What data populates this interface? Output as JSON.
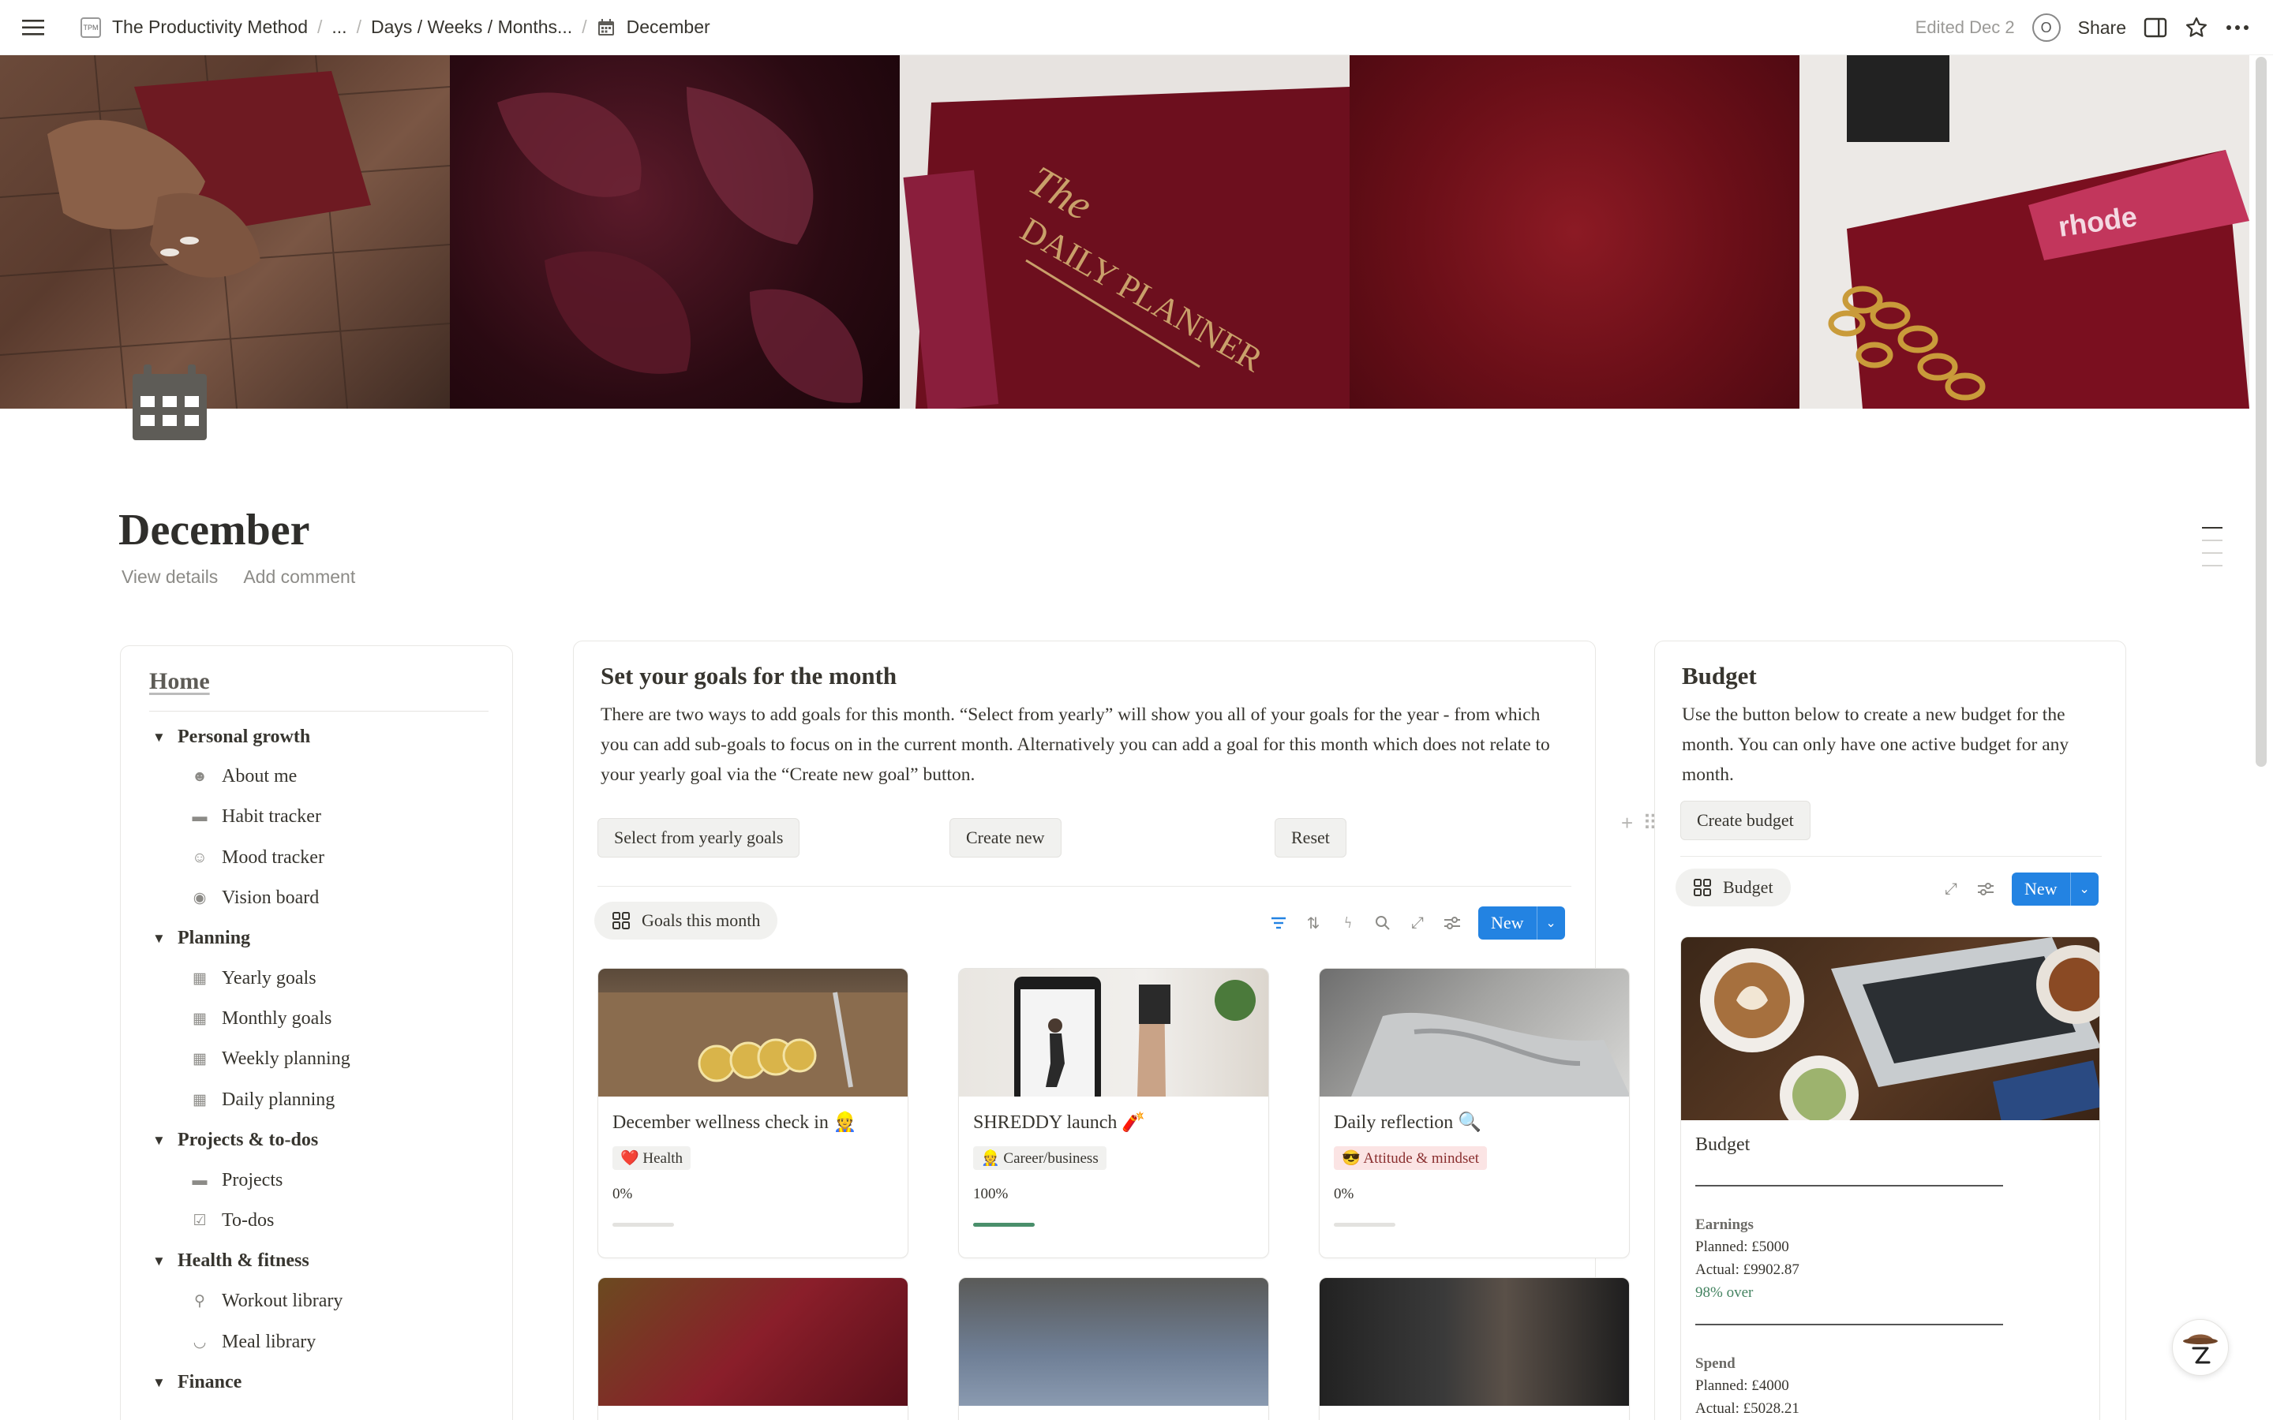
{
  "topbar": {
    "breadcrumbs": [
      "The Productivity Method",
      "...",
      "Days / Weeks / Months...",
      "December"
    ],
    "logo_text": "TPM",
    "edited": "Edited Dec 2",
    "avatar_letter": "O",
    "share": "Share"
  },
  "page": {
    "title": "December",
    "view_details": "View details",
    "add_comment": "Add comment"
  },
  "home": {
    "title": "Home",
    "sections": [
      {
        "label": "Personal growth",
        "items": [
          {
            "label": "About me",
            "icon": "user-icon"
          },
          {
            "label": "Habit tracker",
            "icon": "book-icon"
          },
          {
            "label": "Mood tracker",
            "icon": "smile-icon"
          },
          {
            "label": "Vision board",
            "icon": "eye-icon"
          }
        ]
      },
      {
        "label": "Planning",
        "items": [
          {
            "label": "Yearly goals",
            "icon": "calendar-icon"
          },
          {
            "label": "Monthly goals",
            "icon": "calendar-icon"
          },
          {
            "label": "Weekly planning",
            "icon": "calendar-icon"
          },
          {
            "label": "Daily planning",
            "icon": "calendar-icon"
          }
        ]
      },
      {
        "label": "Projects & to-dos",
        "items": [
          {
            "label": "Projects",
            "icon": "folder-icon"
          },
          {
            "label": "To-dos",
            "icon": "checkbox-icon"
          }
        ]
      },
      {
        "label": "Health & fitness",
        "items": [
          {
            "label": "Workout library",
            "icon": "dumbbell-icon"
          },
          {
            "label": "Meal library",
            "icon": "bowl-icon"
          }
        ]
      },
      {
        "label": "Finance",
        "items": []
      }
    ]
  },
  "goals": {
    "heading": "Set your goals for the month",
    "description": "There are two ways to add goals for this month. “Select from yearly” will show you all of your goals for the year - from which you can add sub-goals to focus on in the current month. Alternatively you can add a goal for this month which does not relate to your yearly goal via the “Create new goal” button.",
    "buttons": {
      "select": "Select from yearly goals",
      "create": "Create new",
      "reset": "Reset"
    },
    "view_tab": "Goals this month",
    "new_label": "New",
    "cards": [
      {
        "title": "December wellness check in 👷",
        "tag": "❤️ Health",
        "tag_bg": "#f1f1ef",
        "tag_color": "#37352f",
        "percent": "0%",
        "progress": 0
      },
      {
        "title": "SHREDDY launch 🧨",
        "tag": "👷 Career/business",
        "tag_bg": "#f1f1ef",
        "tag_color": "#37352f",
        "percent": "100%",
        "progress": 100
      },
      {
        "title": "Daily reflection 🔍",
        "tag": "😎 Attitude & mindset",
        "tag_bg": "#fbe4e4",
        "tag_color": "#8a2f2f",
        "percent": "0%",
        "progress": 0
      }
    ]
  },
  "budget": {
    "heading": "Budget",
    "description": "Use the button below to create a new budget for the month. You can only have one active budget for any month.",
    "create_button": "Create budget",
    "view_tab": "Budget",
    "new_label": "New",
    "card": {
      "title": "Budget",
      "earnings_label": "Earnings",
      "earnings_planned": "Planned: £5000",
      "earnings_actual": "Actual: £9902.87",
      "earnings_over": "98% over",
      "spend_label": "Spend",
      "spend_planned": "Planned: £4000",
      "spend_actual": "Actual: £5028.21"
    }
  }
}
